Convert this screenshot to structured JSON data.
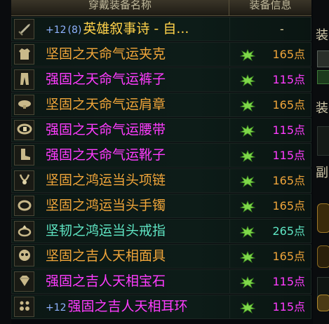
{
  "header": {
    "name_col": "穿戴装备名称",
    "info_col": "装备信息"
  },
  "items": [
    {
      "prefix": "+12",
      "prefix_color": "#8fb3ff",
      "level": "(8)",
      "name": "英雄叙事诗 - 自...",
      "color": "#ffd24a",
      "icon": "sword-icon",
      "gem": false,
      "points": "-",
      "points_color": "#e8d6a0"
    },
    {
      "prefix": "",
      "name": "坚固之天命气运夹克",
      "color": "#f0a53a",
      "icon": "jacket-icon",
      "gem": true,
      "points": "165点",
      "points_color": "#f0a53a"
    },
    {
      "prefix": "",
      "name": "强固之天命气运裤子",
      "color": "#ff3cff",
      "icon": "pants-icon",
      "gem": true,
      "points": "115点",
      "points_color": "#ff3cff"
    },
    {
      "prefix": "",
      "name": "坚固之天命气运肩章",
      "color": "#f0a53a",
      "icon": "shoulder-icon",
      "gem": true,
      "points": "165点",
      "points_color": "#f0a53a"
    },
    {
      "prefix": "",
      "name": "强固之天命气运腰带",
      "color": "#ff3cff",
      "icon": "belt-icon",
      "gem": true,
      "points": "115点",
      "points_color": "#ff3cff"
    },
    {
      "prefix": "",
      "name": "强固之天命气运靴子",
      "color": "#ff3cff",
      "icon": "boots-icon",
      "gem": true,
      "points": "115点",
      "points_color": "#ff3cff"
    },
    {
      "prefix": "",
      "name": "坚固之鸿运当头项链",
      "color": "#f0a53a",
      "icon": "necklace-icon",
      "gem": true,
      "points": "165点",
      "points_color": "#f0a53a"
    },
    {
      "prefix": "",
      "name": "坚固之鸿运当头手镯",
      "color": "#f0a53a",
      "icon": "bracelet-icon",
      "gem": true,
      "points": "165点",
      "points_color": "#f0a53a"
    },
    {
      "prefix": "",
      "name": "坚韧之鸿运当头戒指",
      "color": "#5fe6c4",
      "icon": "ring-icon",
      "gem": true,
      "points": "265点",
      "points_color": "#5fe6c4"
    },
    {
      "prefix": "",
      "name": "坚固之吉人天相面具",
      "color": "#f0a53a",
      "icon": "mask-icon",
      "gem": true,
      "points": "165点",
      "points_color": "#f0a53a"
    },
    {
      "prefix": "",
      "name": "强固之吉人天相宝石",
      "color": "#ff3cff",
      "icon": "gem-stone-icon",
      "gem": true,
      "points": "115点",
      "points_color": "#ff3cff"
    },
    {
      "prefix": "+12",
      "prefix_color": "#8fb3ff",
      "name": "强固之吉人天相耳环",
      "color": "#ff3cff",
      "icon": "earring-icon",
      "gem": true,
      "points": "115点",
      "points_color": "#ff3cff"
    }
  ],
  "side": {
    "chars": [
      "装",
      "装",
      "副"
    ]
  }
}
